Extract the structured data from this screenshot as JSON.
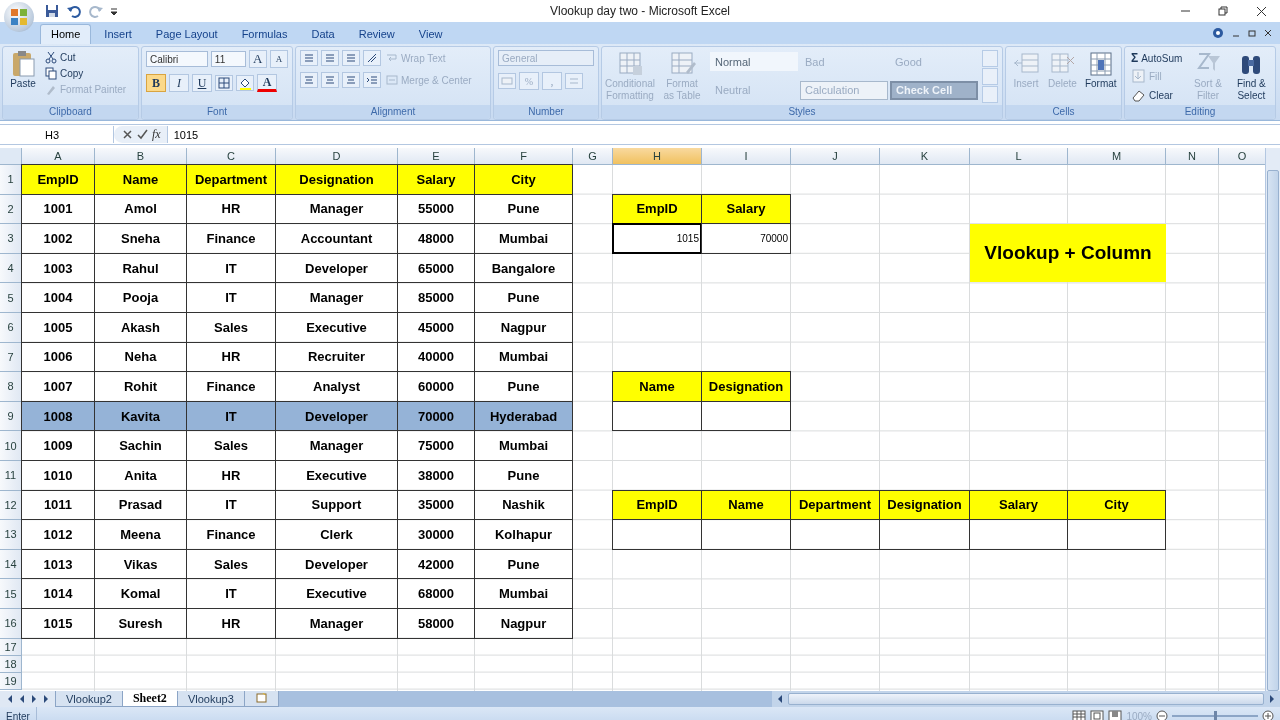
{
  "window": {
    "title": "Vlookup day two - Microsoft Excel"
  },
  "ribbon": {
    "tabs": [
      {
        "label": "Home",
        "selected": true
      },
      {
        "label": "Insert",
        "selected": false
      },
      {
        "label": "Page Layout",
        "selected": false
      },
      {
        "label": "Formulas",
        "selected": false
      },
      {
        "label": "Data",
        "selected": false
      },
      {
        "label": "Review",
        "selected": false
      },
      {
        "label": "View",
        "selected": false
      }
    ],
    "clipboard": {
      "label": "Clipboard",
      "paste": {
        "label": "Paste",
        "disabled": false
      },
      "items": [
        {
          "label": "Cut",
          "disabled": false
        },
        {
          "label": "Copy",
          "disabled": false
        },
        {
          "label": "Format Painter",
          "disabled": true
        }
      ]
    },
    "font": {
      "label": "Font",
      "family": "Calibri",
      "size": "11",
      "grow": "A",
      "shrink": "A",
      "bold": {
        "label": "B",
        "selected": true
      },
      "italic": {
        "label": "I",
        "selected": false
      },
      "underline": {
        "label": "U",
        "selected": false
      },
      "font_color_label": "A"
    },
    "alignment": {
      "label": "Alignment",
      "wrap": {
        "label": "Wrap Text",
        "disabled": true
      },
      "merge": {
        "label": "Merge & Center",
        "disabled": true
      }
    },
    "number": {
      "label": "Number",
      "format": "General",
      "percent": "%",
      "comma": ","
    },
    "styles": {
      "label": "Styles",
      "buttons": [
        {
          "label": "Conditional Formatting",
          "disabled": true
        },
        {
          "label": "Format as Table",
          "disabled": true
        }
      ],
      "cells": [
        {
          "label": "Normal",
          "kind": "normal"
        },
        {
          "label": "Bad",
          "kind": "bad"
        },
        {
          "label": "Good",
          "kind": "good"
        },
        {
          "label": "Neutral",
          "kind": "neutral"
        },
        {
          "label": "Calculation",
          "kind": "calculation"
        },
        {
          "label": "Check Cell",
          "kind": "check"
        }
      ]
    },
    "cells": {
      "label": "Cells",
      "buttons": [
        {
          "label": "Insert",
          "kind": "insert",
          "disabled": true
        },
        {
          "label": "Delete",
          "kind": "delete",
          "disabled": true
        },
        {
          "label": "Format",
          "kind": "format",
          "disabled": false
        }
      ]
    },
    "editing": {
      "label": "Editing",
      "items": [
        {
          "label": "AutoSum",
          "symbol": "Σ",
          "kind": "sum",
          "disabled": false
        },
        {
          "label": "Fill",
          "kind": "fill",
          "disabled": true
        },
        {
          "label": "Clear",
          "kind": "clear",
          "disabled": false
        }
      ],
      "buttons": [
        {
          "label": "Sort & Filter",
          "kind": "sort",
          "disabled": true
        },
        {
          "label": "Find & Select",
          "kind": "find",
          "disabled": false
        }
      ]
    }
  },
  "formula_bar": {
    "name_box": "H3",
    "function_label": "fx",
    "value": "1015"
  },
  "sheet": {
    "columns": [
      {
        "label": "A",
        "selected": false
      },
      {
        "label": "B",
        "selected": false
      },
      {
        "label": "C",
        "selected": false
      },
      {
        "label": "D",
        "selected": false
      },
      {
        "label": "E",
        "selected": false
      },
      {
        "label": "F",
        "selected": false
      },
      {
        "label": "G",
        "selected": false
      },
      {
        "label": "H",
        "selected": true
      },
      {
        "label": "I",
        "selected": false
      },
      {
        "label": "J",
        "selected": false
      },
      {
        "label": "K",
        "selected": false
      },
      {
        "label": "L",
        "selected": false
      },
      {
        "label": "M",
        "selected": false
      },
      {
        "label": "N",
        "selected": false
      },
      {
        "label": "O",
        "selected": false
      }
    ],
    "rows": [
      {
        "label": "1",
        "cells": [
          {
            "kind": "head",
            "text": "EmpID"
          },
          {
            "kind": "head",
            "text": "Name"
          },
          {
            "kind": "head",
            "text": "Department"
          },
          {
            "kind": "head",
            "text": "Designation"
          },
          {
            "kind": "head",
            "text": "Salary"
          },
          {
            "kind": "head",
            "text": "City"
          }
        ]
      },
      {
        "label": "2",
        "cells": [
          {
            "kind": "text",
            "text": "1001"
          },
          {
            "kind": "text",
            "text": "Amol"
          },
          {
            "kind": "text",
            "text": "HR"
          },
          {
            "kind": "text",
            "text": "Manager"
          },
          {
            "kind": "text",
            "text": "55000"
          },
          {
            "kind": "text",
            "text": "Pune"
          },
          {
            "kind": "blank"
          },
          {
            "kind": "head",
            "text": "EmpID"
          },
          {
            "kind": "head",
            "text": "Salary"
          }
        ]
      },
      {
        "label": "3",
        "cells": [
          {
            "kind": "text",
            "text": "1002"
          },
          {
            "kind": "text",
            "text": "Sneha"
          },
          {
            "kind": "text",
            "text": "Finance"
          },
          {
            "kind": "text",
            "text": "Accountant"
          },
          {
            "kind": "text",
            "text": "48000"
          },
          {
            "kind": "text",
            "text": "Mumbai"
          },
          {
            "kind": "blank"
          },
          {
            "kind": "active",
            "text": "1015"
          },
          {
            "kind": "value",
            "text": "70000"
          }
        ]
      },
      {
        "label": "4",
        "cells": [
          {
            "kind": "text",
            "text": "1003"
          },
          {
            "kind": "text",
            "text": "Rahul"
          },
          {
            "kind": "text",
            "text": "IT"
          },
          {
            "kind": "text",
            "text": "Developer"
          },
          {
            "kind": "text",
            "text": "65000"
          },
          {
            "kind": "text",
            "text": "Bangalore"
          }
        ]
      },
      {
        "label": "5",
        "cells": [
          {
            "kind": "text",
            "text": "1004"
          },
          {
            "kind": "text",
            "text": "Pooja"
          },
          {
            "kind": "text",
            "text": "IT"
          },
          {
            "kind": "text",
            "text": "Manager"
          },
          {
            "kind": "text",
            "text": "85000"
          },
          {
            "kind": "text",
            "text": "Pune"
          }
        ]
      },
      {
        "label": "6",
        "cells": [
          {
            "kind": "text",
            "text": "1005"
          },
          {
            "kind": "text",
            "text": "Akash"
          },
          {
            "kind": "text",
            "text": "Sales"
          },
          {
            "kind": "text",
            "text": "Executive"
          },
          {
            "kind": "text",
            "text": "45000"
          },
          {
            "kind": "text",
            "text": "Nagpur"
          }
        ]
      },
      {
        "label": "7",
        "cells": [
          {
            "kind": "text",
            "text": "1006"
          },
          {
            "kind": "text",
            "text": "Neha"
          },
          {
            "kind": "text",
            "text": "HR"
          },
          {
            "kind": "text",
            "text": "Recruiter"
          },
          {
            "kind": "text",
            "text": "40000"
          },
          {
            "kind": "text",
            "text": "Mumbai"
          }
        ]
      },
      {
        "label": "8",
        "cells": [
          {
            "kind": "text",
            "text": "1007"
          },
          {
            "kind": "text",
            "text": "Rohit"
          },
          {
            "kind": "text",
            "text": "Finance"
          },
          {
            "kind": "text",
            "text": "Analyst"
          },
          {
            "kind": "text",
            "text": "60000"
          },
          {
            "kind": "text",
            "text": "Pune"
          },
          {
            "kind": "blank"
          },
          {
            "kind": "head",
            "text": "Name"
          },
          {
            "kind": "head",
            "text": "Designation"
          }
        ]
      },
      {
        "label": "9",
        "cells": [
          {
            "kind": "highlight",
            "text": "1008"
          },
          {
            "kind": "highlight",
            "text": "Kavita"
          },
          {
            "kind": "highlight",
            "text": "IT"
          },
          {
            "kind": "highlight",
            "text": "Developer"
          },
          {
            "kind": "highlight",
            "text": "70000"
          },
          {
            "kind": "highlight",
            "text": "Hyderabad"
          },
          {
            "kind": "blank"
          },
          {
            "kind": "input"
          },
          {
            "kind": "input"
          }
        ]
      },
      {
        "label": "10",
        "cells": [
          {
            "kind": "text",
            "text": "1009"
          },
          {
            "kind": "text",
            "text": "Sachin"
          },
          {
            "kind": "text",
            "text": "Sales"
          },
          {
            "kind": "text",
            "text": "Manager"
          },
          {
            "kind": "text",
            "text": "75000"
          },
          {
            "kind": "text",
            "text": "Mumbai"
          }
        ]
      },
      {
        "label": "11",
        "cells": [
          {
            "kind": "text",
            "text": "1010"
          },
          {
            "kind": "text",
            "text": "Anita"
          },
          {
            "kind": "text",
            "text": "HR"
          },
          {
            "kind": "text",
            "text": "Executive"
          },
          {
            "kind": "text",
            "text": "38000"
          },
          {
            "kind": "text",
            "text": "Pune"
          }
        ]
      },
      {
        "label": "12",
        "cells": [
          {
            "kind": "text",
            "text": "1011"
          },
          {
            "kind": "text",
            "text": "Prasad"
          },
          {
            "kind": "text",
            "text": "IT"
          },
          {
            "kind": "text",
            "text": "Support"
          },
          {
            "kind": "text",
            "text": "35000"
          },
          {
            "kind": "text",
            "text": "Nashik"
          },
          {
            "kind": "blank"
          },
          {
            "kind": "head",
            "text": "EmpID"
          },
          {
            "kind": "head",
            "text": "Name"
          },
          {
            "kind": "head",
            "text": "Department"
          },
          {
            "kind": "head",
            "text": "Designation"
          },
          {
            "kind": "head",
            "text": "Salary"
          },
          {
            "kind": "head",
            "text": "City"
          }
        ]
      },
      {
        "label": "13",
        "cells": [
          {
            "kind": "text",
            "text": "1012"
          },
          {
            "kind": "text",
            "text": "Meena"
          },
          {
            "kind": "text",
            "text": "Finance"
          },
          {
            "kind": "text",
            "text": "Clerk"
          },
          {
            "kind": "text",
            "text": "30000"
          },
          {
            "kind": "text",
            "text": "Kolhapur"
          },
          {
            "kind": "blank"
          },
          {
            "kind": "input"
          },
          {
            "kind": "input"
          },
          {
            "kind": "input"
          },
          {
            "kind": "input"
          },
          {
            "kind": "input"
          },
          {
            "kind": "input"
          }
        ]
      },
      {
        "label": "14",
        "cells": [
          {
            "kind": "text",
            "text": "1013"
          },
          {
            "kind": "text",
            "text": "Vikas"
          },
          {
            "kind": "text",
            "text": "Sales"
          },
          {
            "kind": "text",
            "text": "Developer"
          },
          {
            "kind": "text",
            "text": "42000"
          },
          {
            "kind": "text",
            "text": "Pune"
          }
        ]
      },
      {
        "label": "15",
        "cells": [
          {
            "kind": "text",
            "text": "1014"
          },
          {
            "kind": "text",
            "text": "Komal"
          },
          {
            "kind": "text",
            "text": "IT"
          },
          {
            "kind": "text",
            "text": "Executive"
          },
          {
            "kind": "text",
            "text": "68000"
          },
          {
            "kind": "text",
            "text": "Mumbai"
          }
        ]
      },
      {
        "label": "16",
        "cells": [
          {
            "kind": "text",
            "text": "1015"
          },
          {
            "kind": "text",
            "text": "Suresh"
          },
          {
            "kind": "text",
            "text": "HR"
          },
          {
            "kind": "text",
            "text": "Manager"
          },
          {
            "kind": "text",
            "text": "58000"
          },
          {
            "kind": "text",
            "text": "Nagpur"
          }
        ]
      },
      {
        "label": "17"
      },
      {
        "label": "18"
      },
      {
        "label": "19"
      }
    ],
    "banner": {
      "text": "Vlookup + Column"
    }
  },
  "sheet_tabs": [
    {
      "label": "Vlookup2",
      "selected": false
    },
    {
      "label": "Sheet2",
      "selected": true
    },
    {
      "label": "Vlookup3",
      "selected": false
    }
  ],
  "status_bar": {
    "mode": "Enter",
    "zoom": "100%",
    "zoom_slider": {
      "level": 0.5
    }
  }
}
